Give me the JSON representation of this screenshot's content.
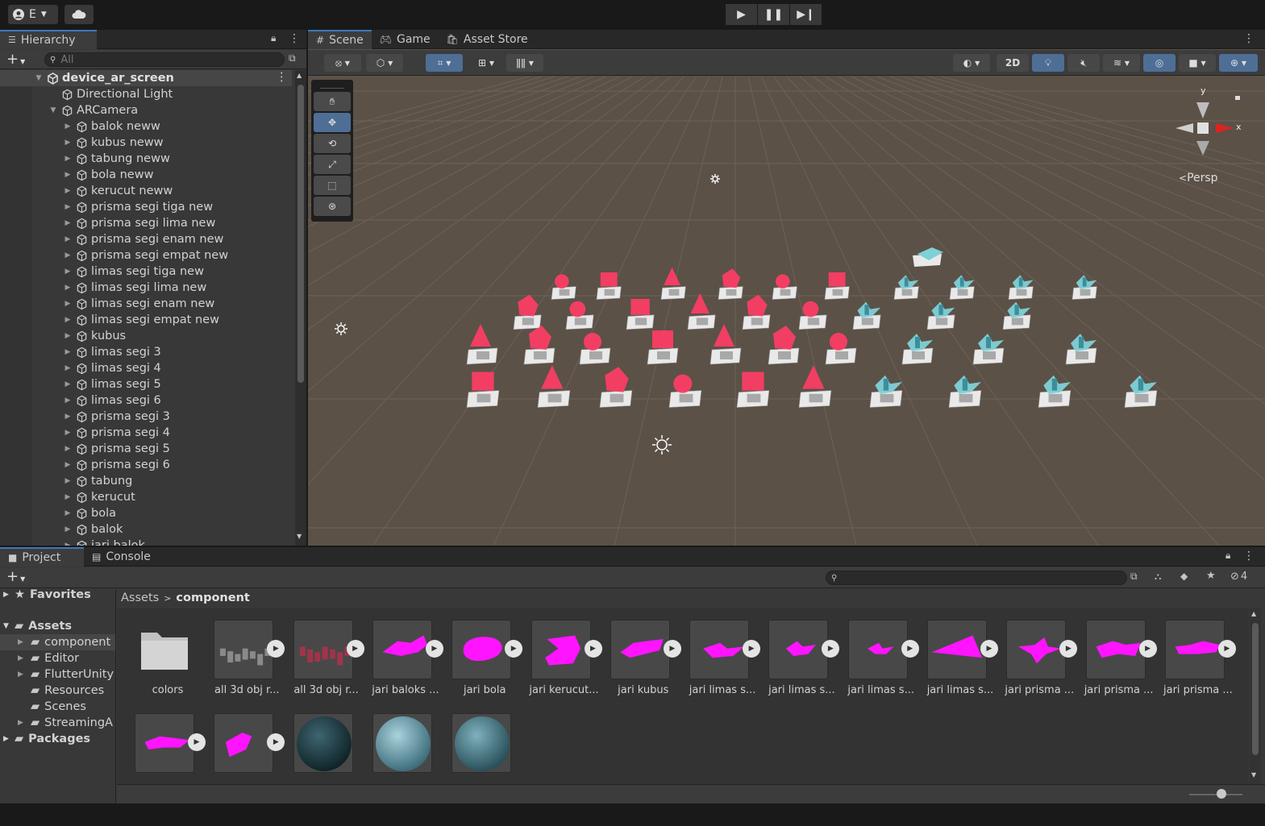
{
  "toolbar": {
    "account_label": "E"
  },
  "hierarchy": {
    "tab": "Hierarchy",
    "search_placeholder": "All",
    "scene_name": "device_ar_screen",
    "items": [
      {
        "label": "Directional Light",
        "depth": 1,
        "arrow": ""
      },
      {
        "label": "ARCamera",
        "depth": 1,
        "arrow": "▼"
      },
      {
        "label": "balok neww",
        "depth": 2,
        "arrow": "▶"
      },
      {
        "label": "kubus neww",
        "depth": 2,
        "arrow": "▶"
      },
      {
        "label": "tabung neww",
        "depth": 2,
        "arrow": "▶"
      },
      {
        "label": "bola neww",
        "depth": 2,
        "arrow": "▶"
      },
      {
        "label": "kerucut neww",
        "depth": 2,
        "arrow": "▶"
      },
      {
        "label": "prisma segi tiga new",
        "depth": 2,
        "arrow": "▶"
      },
      {
        "label": "prisma segi lima new",
        "depth": 2,
        "arrow": "▶"
      },
      {
        "label": "prisma segi enam new",
        "depth": 2,
        "arrow": "▶"
      },
      {
        "label": "prisma segi empat new",
        "depth": 2,
        "arrow": "▶"
      },
      {
        "label": "limas segi tiga new",
        "depth": 2,
        "arrow": "▶"
      },
      {
        "label": "limas segi lima new",
        "depth": 2,
        "arrow": "▶"
      },
      {
        "label": "limas segi enam new",
        "depth": 2,
        "arrow": "▶"
      },
      {
        "label": "limas segi empat new",
        "depth": 2,
        "arrow": "▶"
      },
      {
        "label": "kubus",
        "depth": 2,
        "arrow": "▶"
      },
      {
        "label": "limas segi 3",
        "depth": 2,
        "arrow": "▶"
      },
      {
        "label": "limas segi 4",
        "depth": 2,
        "arrow": "▶"
      },
      {
        "label": "limas segi 5",
        "depth": 2,
        "arrow": "▶"
      },
      {
        "label": "limas segi 6",
        "depth": 2,
        "arrow": "▶"
      },
      {
        "label": "prisma segi 3",
        "depth": 2,
        "arrow": "▶"
      },
      {
        "label": "prisma segi 4",
        "depth": 2,
        "arrow": "▶"
      },
      {
        "label": "prisma segi 5",
        "depth": 2,
        "arrow": "▶"
      },
      {
        "label": "prisma segi 6",
        "depth": 2,
        "arrow": "▶"
      },
      {
        "label": "tabung",
        "depth": 2,
        "arrow": "▶"
      },
      {
        "label": "kerucut",
        "depth": 2,
        "arrow": "▶"
      },
      {
        "label": "bola",
        "depth": 2,
        "arrow": "▶"
      },
      {
        "label": "balok",
        "depth": 2,
        "arrow": "▶"
      },
      {
        "label": "jari balok",
        "depth": 2,
        "arrow": "▶"
      }
    ]
  },
  "scene": {
    "tabs": [
      {
        "label": "Scene",
        "icon": "grid-icon"
      },
      {
        "label": "Game",
        "icon": "gamepad-icon"
      },
      {
        "label": "Asset Store",
        "icon": "bag-icon"
      }
    ],
    "mode_2d": "2D",
    "persp_label": "Persp",
    "gizmo_x": "x",
    "gizmo_y": "y"
  },
  "project": {
    "tabs": [
      {
        "label": "Project",
        "icon": "folder-icon"
      },
      {
        "label": "Console",
        "icon": "console-icon"
      }
    ],
    "hidden_count": "4",
    "breadcrumb": {
      "root": "Assets",
      "current": "component"
    },
    "favorites": "Favorites",
    "assets_root": "Assets",
    "folders": [
      {
        "label": "component",
        "arrow": "▶",
        "selected": true
      },
      {
        "label": "Editor",
        "arrow": "▶"
      },
      {
        "label": "FlutterUnity",
        "arrow": "▶"
      },
      {
        "label": "Resources",
        "arrow": ""
      },
      {
        "label": "Scenes",
        "arrow": ""
      },
      {
        "label": "StreamingA",
        "arrow": "▶"
      }
    ],
    "packages": "Packages",
    "assets": [
      {
        "label": "colors",
        "kind": "folder"
      },
      {
        "label": "all 3d obj r...",
        "kind": "model-grey"
      },
      {
        "label": "all 3d obj r...",
        "kind": "model-red"
      },
      {
        "label": "jari baloks ...",
        "kind": "blob"
      },
      {
        "label": "jari bola",
        "kind": "blob"
      },
      {
        "label": "jari kerucut...",
        "kind": "blob"
      },
      {
        "label": "jari kubus",
        "kind": "blob"
      },
      {
        "label": "jari limas s...",
        "kind": "blob"
      },
      {
        "label": "jari limas s...",
        "kind": "blob"
      },
      {
        "label": "jari limas s...",
        "kind": "blob"
      },
      {
        "label": "jari limas s...",
        "kind": "blob"
      },
      {
        "label": "jari prisma ...",
        "kind": "blob"
      },
      {
        "label": "jari prisma ...",
        "kind": "blob"
      },
      {
        "label": "jari prisma ...",
        "kind": "blob"
      },
      {
        "label": "",
        "kind": "blob"
      },
      {
        "label": "",
        "kind": "blob"
      },
      {
        "label": "",
        "kind": "sphere-dark"
      },
      {
        "label": "",
        "kind": "sphere-light"
      },
      {
        "label": "",
        "kind": "sphere-mid"
      }
    ]
  }
}
